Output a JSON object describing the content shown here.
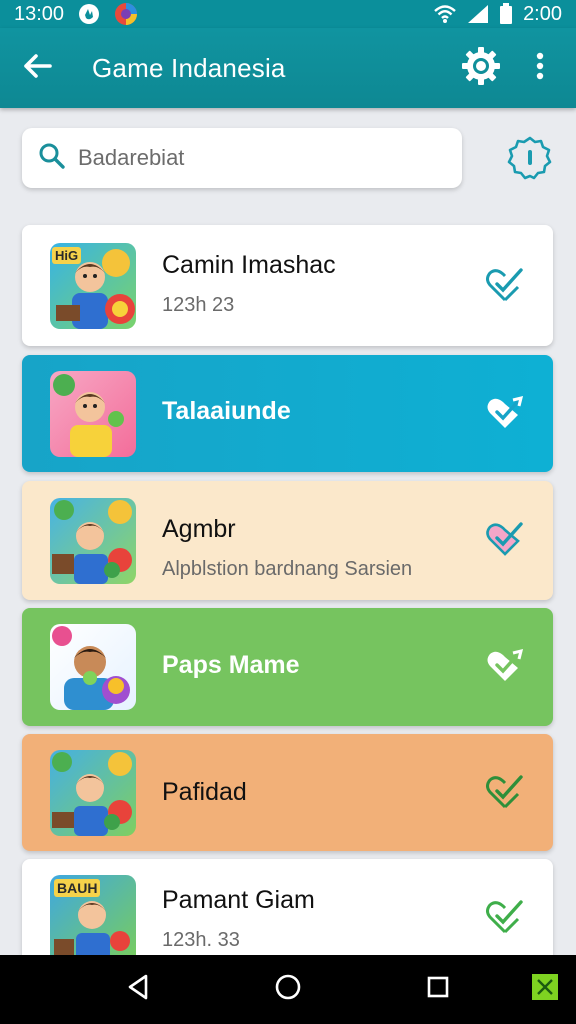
{
  "status_bar": {
    "time_left": "13:00",
    "time_right": "2:00",
    "icons": [
      "hand-notification-icon",
      "color-app-icon",
      "wifi-icon",
      "signal-icon",
      "battery-icon"
    ]
  },
  "app_bar": {
    "title": "Game Indanesia",
    "back_icon": "arrow-left-icon",
    "settings_icon": "gear-icon",
    "more_icon": "more-vert-icon"
  },
  "search": {
    "placeholder": "Badarebiat",
    "value": ""
  },
  "filter_icon": "badge-filter-icon",
  "colors": {
    "teal": "#0b8f9b",
    "blue_card": "#15a9cc",
    "cream_card": "#fbe8cb",
    "green_card": "#76c45f",
    "orange_card": "#f2b078",
    "white_card": "#ffffff"
  },
  "games": [
    {
      "title": "Camin Imashac",
      "subtitle": "123h 23",
      "thumb_label": "HiG",
      "check_icon": "heart-check-icon"
    },
    {
      "title": "Talaaiunde",
      "subtitle": "",
      "thumb_label": "",
      "check_icon": "heart-check-icon"
    },
    {
      "title": "Agmbr",
      "subtitle": "Alpblstion bardnang Sarsien",
      "thumb_label": "",
      "check_icon": "heart-check-icon"
    },
    {
      "title": "Paps Mame",
      "subtitle": "",
      "thumb_label": "",
      "check_icon": "heart-check-icon"
    },
    {
      "title": "Pafidad",
      "subtitle": "",
      "thumb_label": "",
      "check_icon": "heart-check-icon"
    },
    {
      "title": "Pamant Giam",
      "subtitle": "123h. 33",
      "thumb_label": "BAUH",
      "check_icon": "heart-check-icon"
    }
  ],
  "nav_bar": {
    "back_icon": "nav-back-icon",
    "home_icon": "nav-home-icon",
    "recents_icon": "nav-recents-icon",
    "extra_icon": "green-x-icon"
  }
}
